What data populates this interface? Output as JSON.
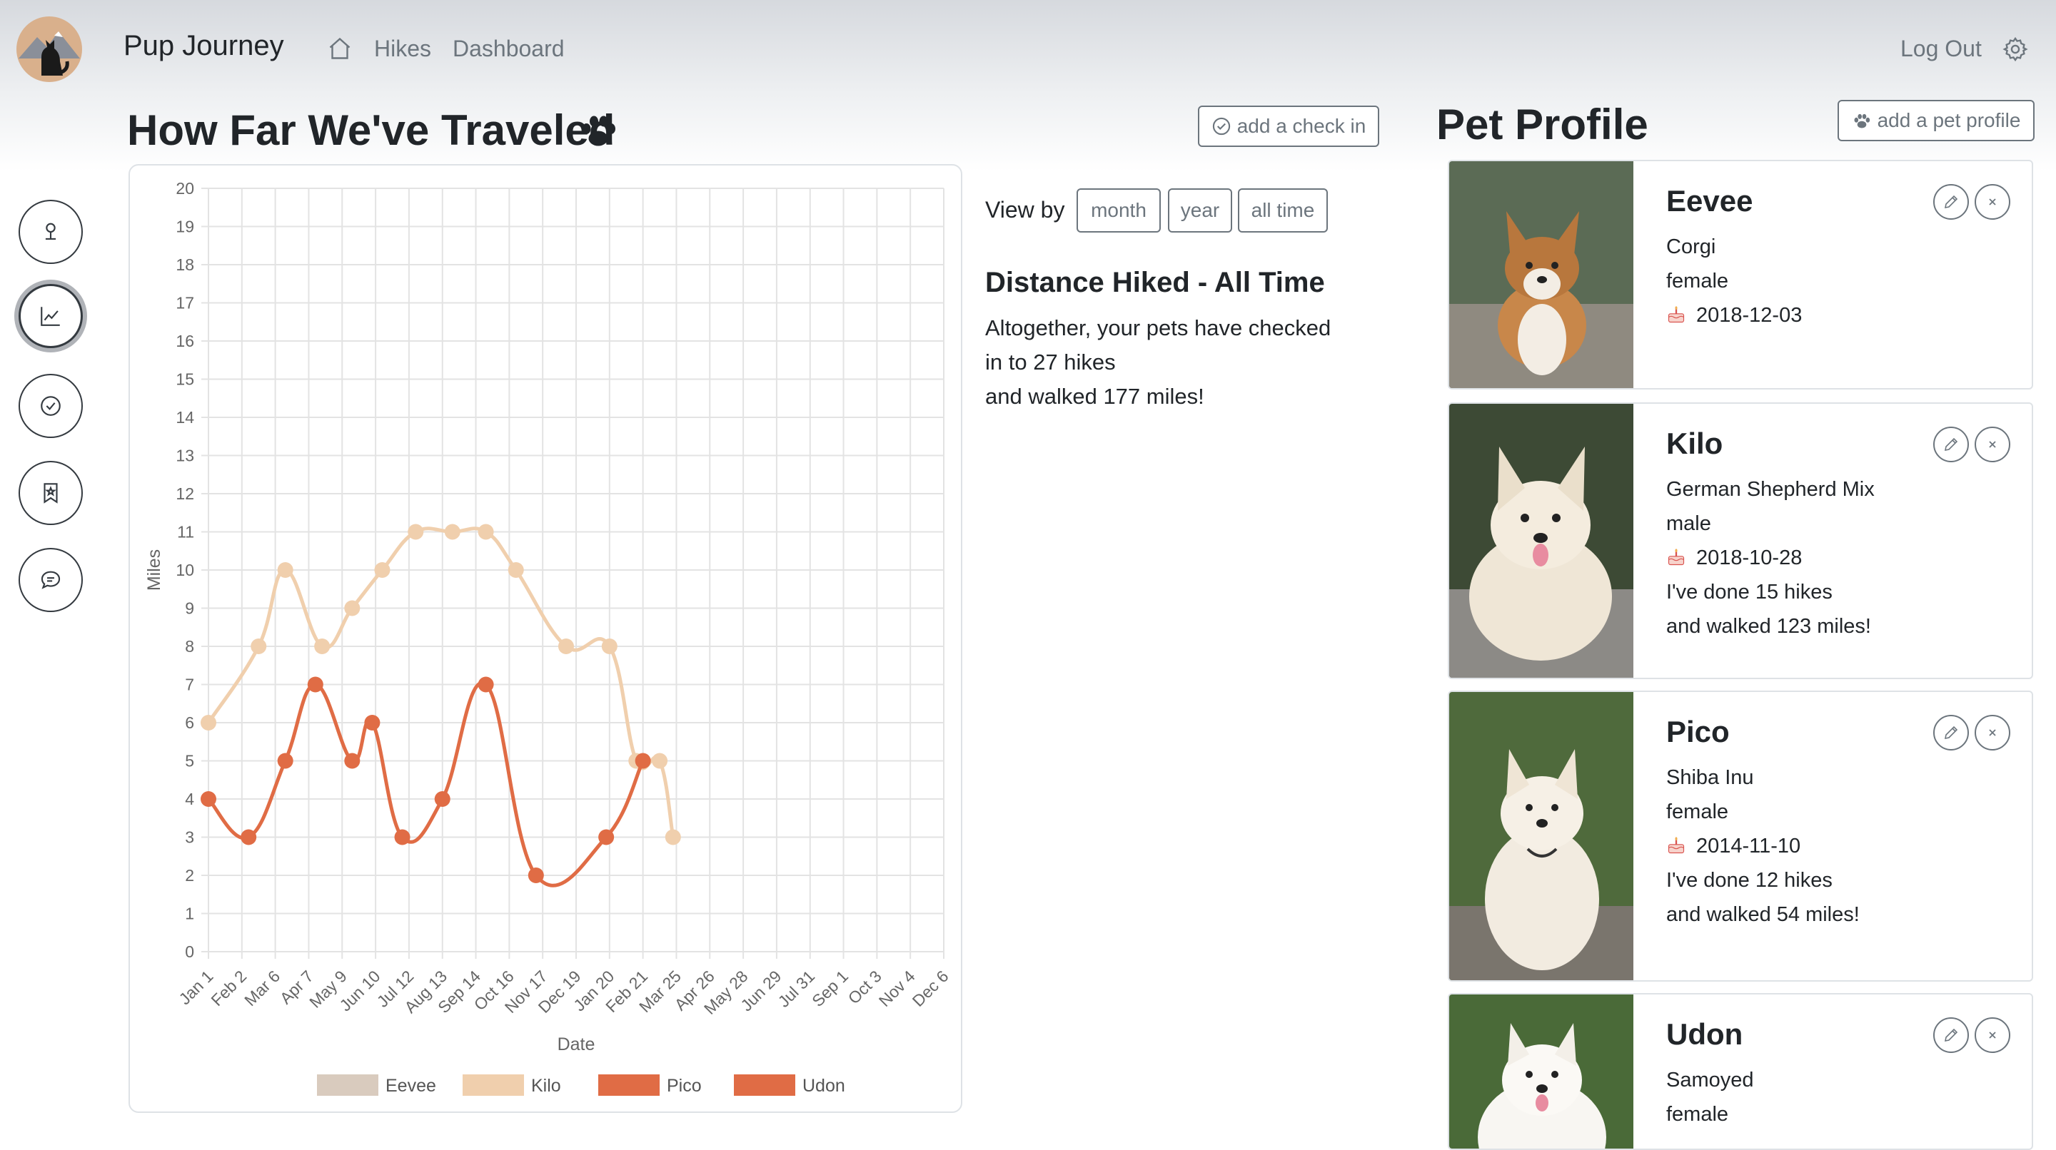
{
  "app": {
    "brand": "Pup Journey",
    "nav": {
      "hikes": "Hikes",
      "dashboard": "Dashboard"
    },
    "logout": "Log Out"
  },
  "sidebar": {
    "items": [
      {
        "icon": "map-pin-icon",
        "active": false
      },
      {
        "icon": "line-chart-icon",
        "active": true
      },
      {
        "icon": "check-circle-icon",
        "active": false
      },
      {
        "icon": "bookmark-star-icon",
        "active": false
      },
      {
        "icon": "chat-icon",
        "active": false
      }
    ]
  },
  "dashboard": {
    "title": "How Far We've Traveled",
    "add_checkin": "add a check in",
    "view_by_label": "View by",
    "view_by_options": [
      "month",
      "year",
      "all time"
    ],
    "distance_title": "Distance Hiked - All Time",
    "summary": [
      "Altogether, your pets have checked",
      "in to 27 hikes",
      "and walked 177 miles!"
    ]
  },
  "pet_profile": {
    "title": "Pet Profile",
    "add_pet": "add a pet profile",
    "pets": [
      {
        "name": "Eevee",
        "breed": "Corgi",
        "sex": "female",
        "birthday": "2018-12-03"
      },
      {
        "name": "Kilo",
        "breed": "German Shepherd Mix",
        "sex": "male",
        "birthday": "2018-10-28",
        "hikes": "I've done 15 hikes",
        "miles": "and walked 123 miles!"
      },
      {
        "name": "Pico",
        "breed": "Shiba Inu",
        "sex": "female",
        "birthday": "2014-11-10",
        "hikes": "I've done 12 hikes",
        "miles": "and walked 54 miles!"
      },
      {
        "name": "Udon",
        "breed": "Samoyed",
        "sex": "female"
      }
    ]
  },
  "chart_data": {
    "type": "line",
    "xlabel": "Date",
    "ylabel": "Miles",
    "ylim": [
      0,
      20
    ],
    "grid": true,
    "legend_position": "bottom",
    "categories": [
      "Jan 1",
      "Feb 2",
      "Mar 6",
      "Apr 7",
      "May 9",
      "Jun 10",
      "Jul 12",
      "Aug 13",
      "Sep 14",
      "Oct 16",
      "Nov 17",
      "Dec 19",
      "Jan 20",
      "Feb 21",
      "Mar 25",
      "Apr 26",
      "May 28",
      "Jun 29",
      "Jul 31",
      "Sep 1",
      "Oct 3",
      "Nov 4",
      "Dec 6"
    ],
    "series": [
      {
        "name": "Eevee",
        "color": "#d9cbbe",
        "points": []
      },
      {
        "name": "Kilo",
        "color": "#f0cfad",
        "points": [
          [
            0,
            6
          ],
          [
            1.5,
            8
          ],
          [
            2.3,
            10
          ],
          [
            3.4,
            8
          ],
          [
            4.3,
            9
          ],
          [
            5.2,
            10
          ],
          [
            6.2,
            11
          ],
          [
            7.3,
            11
          ],
          [
            8.3,
            11
          ],
          [
            9.2,
            10
          ],
          [
            10.7,
            8
          ],
          [
            12,
            8
          ],
          [
            12.8,
            5
          ],
          [
            13.5,
            5
          ],
          [
            13.9,
            3
          ]
        ]
      },
      {
        "name": "Pico",
        "color": "#e06c45",
        "points": [
          [
            0,
            4
          ],
          [
            1.2,
            3
          ],
          [
            2.3,
            5
          ],
          [
            3.2,
            7
          ],
          [
            4.3,
            5
          ],
          [
            4.9,
            6
          ],
          [
            5.8,
            3
          ],
          [
            7,
            4
          ],
          [
            8.3,
            7
          ],
          [
            9.8,
            2
          ],
          [
            11.9,
            3
          ],
          [
            13,
            5
          ]
        ]
      },
      {
        "name": "Udon",
        "color": "#e06c45",
        "points": []
      }
    ]
  }
}
